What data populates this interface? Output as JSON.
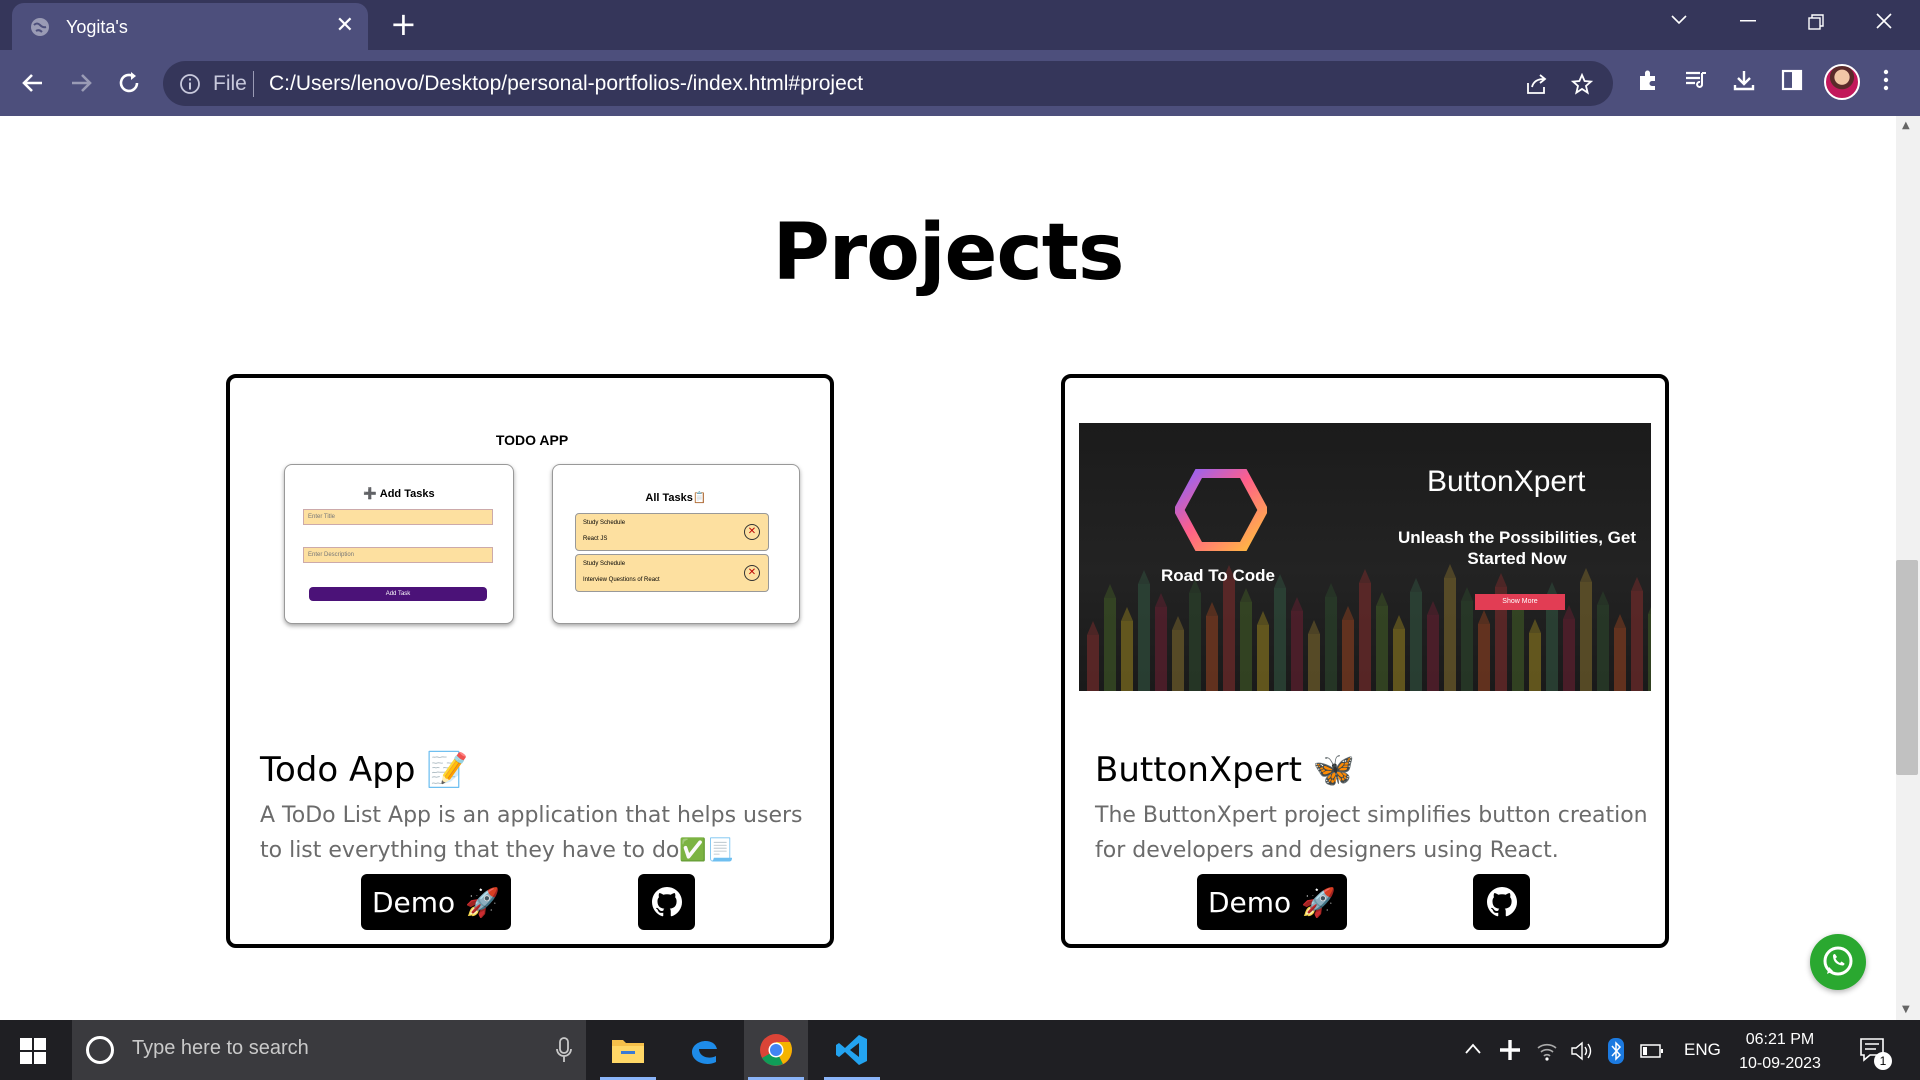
{
  "browser": {
    "tab_title": "Yogita's",
    "new_tab_symbol": "+",
    "address_scheme_label": "File",
    "url": "C:/Users/lenovo/Desktop/personal-portfolios-/index.html#project"
  },
  "page": {
    "section_title": "Projects",
    "projects": [
      {
        "name": "Todo App",
        "emoji": "📝",
        "description": "A ToDo List App is an application that helps users to list everything that they have to do✅📃",
        "demo_label": "Demo",
        "demo_emoji": "🚀",
        "preview": {
          "heading": "TODO APP",
          "add_panel_title": "➕ Add Tasks",
          "title_placeholder": "Enter Title",
          "desc_placeholder": "Enter Description",
          "add_button": "Add Task",
          "all_panel_title": "All Tasks📋",
          "tasks": [
            {
              "title": "Study Schedule",
              "desc": "React JS"
            },
            {
              "title": "Study Schedule",
              "desc": "Interview Questions of React"
            }
          ]
        }
      },
      {
        "name": "ButtonXpert",
        "emoji": "🦋",
        "description": "The ButtonXpert project simplifies button creation for developers and designers using React.",
        "demo_label": "Demo",
        "demo_emoji": "🚀",
        "preview": {
          "brand": "Road To Code",
          "title": "ButtonXpert",
          "tagline": "Unleash the Possibilities, Get Started Now",
          "button": "Show More"
        }
      }
    ]
  },
  "taskbar": {
    "search_placeholder": "Type here to search",
    "language": "ENG",
    "time": "06:21 PM",
    "date": "10-09-2023",
    "notification_count": "1"
  },
  "colors": {
    "chrome_dark": "#35365a",
    "chrome_light": "#4d4f7c",
    "whatsapp": "#2aa830",
    "todo_accent": "#4b1278",
    "bx_button": "#e23d54"
  }
}
